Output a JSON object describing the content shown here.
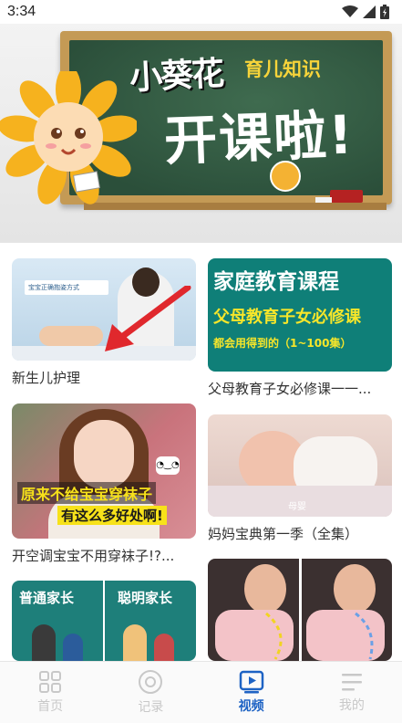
{
  "status_bar": {
    "time": "3:34"
  },
  "banner": {
    "brand": "小葵花",
    "brand_sub": "育儿知识",
    "headline": "开课啦!"
  },
  "videos": [
    {
      "title": "新生儿护理",
      "thumb_caption": "宝宝正确抱姿方式"
    },
    {
      "title": "父母教育子女必修课一一...",
      "thumb_line1": "家庭教育课程",
      "thumb_line2": "父母教育子女必修课",
      "thumb_line3": "都会用得到的（1~100集）"
    },
    {
      "title": "开空调宝宝不用穿袜子!?...",
      "thumb_line1": "原来不给宝宝穿袜子",
      "thumb_line2": "有这么多好处啊!"
    },
    {
      "title": "妈妈宝典第一季（全集）",
      "thumb_caption": "母婴"
    },
    {
      "title": "",
      "thumb_left": "普通家长",
      "thumb_right": "聪明家长"
    },
    {
      "title": ""
    }
  ],
  "bottom_nav": [
    {
      "label": "首页",
      "icon": "grid-icon",
      "active": false
    },
    {
      "label": "记录",
      "icon": "record-icon",
      "active": false
    },
    {
      "label": "视频",
      "icon": "video-icon",
      "active": true
    },
    {
      "label": "我的",
      "icon": "menu-icon",
      "active": false
    }
  ],
  "colors": {
    "accent": "#1e63c4",
    "teal": "#0f7f78",
    "board": "#2b4f3a"
  }
}
